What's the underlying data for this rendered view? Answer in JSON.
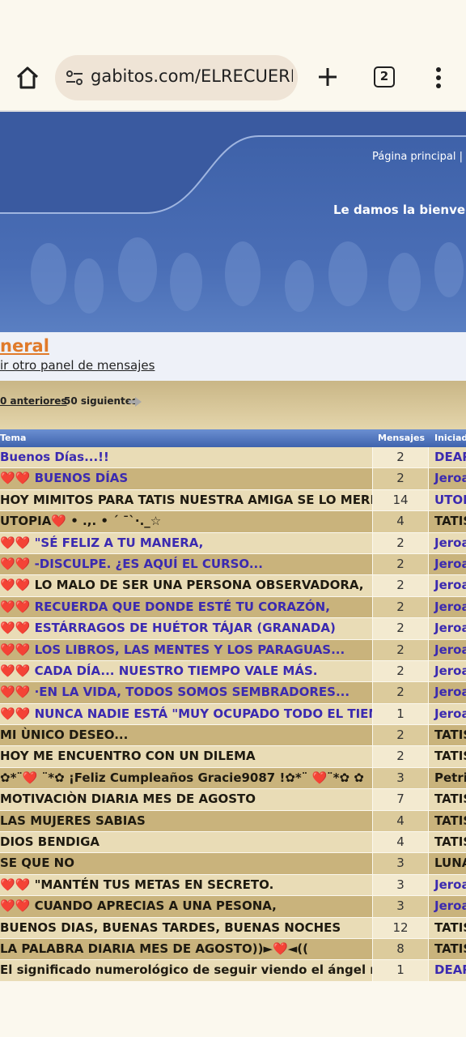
{
  "browser": {
    "url": "gabitos.com/ELRECUERDO",
    "tab_count": "2",
    "icons": [
      "home-icon",
      "site-settings-icon",
      "plus-icon",
      "tabs-icon",
      "more-vert-icon"
    ]
  },
  "header": {
    "nav": "Página principal  |",
    "welcome": "Le damos la bienvenida"
  },
  "forum": {
    "title": "neral",
    "go_link": "ir otro panel de mensajes"
  },
  "pager": {
    "prev": "0 anteriores",
    "next": "50 siguientes"
  },
  "table": {
    "columns": [
      "Tema",
      "Mensajes",
      "Iniciado"
    ],
    "rows": [
      {
        "title": "Buenos Días...!!",
        "count": "2",
        "author": "DEAR",
        "style": "link"
      },
      {
        "title": "❤️❤️ BUENOS DÍAS",
        "count": "2",
        "author": "Jeroa",
        "style": "link"
      },
      {
        "title": "HOY MIMITOS PARA TATIS NUESTRA AMIGA SE LO MERECE",
        "count": "14",
        "author": "UTOP",
        "style": "dark"
      },
      {
        "title": "UTOPIA❤️ • .,. • ´ ¯`·._☆",
        "count": "4",
        "author": "TATIS",
        "style": "dark"
      },
      {
        "title": "❤️❤️ \"SÉ FELIZ A TU MANERA,",
        "count": "2",
        "author": "Jeroa",
        "style": "link"
      },
      {
        "title": "❤️❤️ -DISCULPE. ¿ES AQUÍ EL CURSO...",
        "count": "2",
        "author": "Jeroa",
        "style": "link"
      },
      {
        "title": "❤️❤️ LO MALO DE SER UNA PERSONA OBSERVADORA,",
        "count": "2",
        "author": "Jeroa",
        "style": "dark"
      },
      {
        "title": "❤️❤️ RECUERDA QUE DONDE ESTÉ TU CORAZÓN,",
        "count": "2",
        "author": "Jeroa",
        "style": "link"
      },
      {
        "title": "❤️❤️ ESTÁRRAGOS DE HUÉTOR TÁJAR (GRANADA)",
        "count": "2",
        "author": "Jeroa",
        "style": "link"
      },
      {
        "title": "❤️❤️ LOS LIBROS, LAS MENTES Y LOS PARAGUAS...",
        "count": "2",
        "author": "Jeroa",
        "style": "link"
      },
      {
        "title": "❤️❤️ CADA DÍA... NUESTRO TIEMPO VALE MÁS.",
        "count": "2",
        "author": "Jeroa",
        "style": "link"
      },
      {
        "title": "❤️❤️ ·EN LA VIDA, TODOS SOMOS SEMBRADORES...",
        "count": "2",
        "author": "Jeroa",
        "style": "link"
      },
      {
        "title": "❤️❤️ NUNCA NADIE ESTÁ \"MUY OCUPADO TODO EL TIEMPO",
        "count": "1",
        "author": "Jeroa",
        "style": "link"
      },
      {
        "title": "MI ÙNICO DESEO...",
        "count": "2",
        "author": "TATIS",
        "style": "dark"
      },
      {
        "title": "HOY ME ENCUENTRO CON UN DILEMA",
        "count": "2",
        "author": "TATIS",
        "style": "dark"
      },
      {
        "title": "✿*¨❤️ ¨*✿ ¡Feliz Cumpleaños Gracie9087 !✿*¨ ❤️¨*✿ ✿",
        "count": "3",
        "author": "Petri",
        "style": "dark"
      },
      {
        "title": "MOTIVACIÒN DIARIA MES DE AGOSTO",
        "count": "7",
        "author": "TATIS",
        "style": "dark"
      },
      {
        "title": "LAS MUJERES SABIAS",
        "count": "4",
        "author": "TATIS",
        "style": "dark"
      },
      {
        "title": "DIOS BENDIGA",
        "count": "4",
        "author": "TATIS",
        "style": "dark"
      },
      {
        "title": "SE QUE NO",
        "count": "3",
        "author": "LUNA",
        "style": "dark"
      },
      {
        "title": "❤️❤️ \"MANTÉN TUS METAS EN SECRETO.",
        "count": "3",
        "author": "Jeroa",
        "style": "dark"
      },
      {
        "title": "❤️❤️ CUANDO APRECIAS A UNA PESONA,",
        "count": "3",
        "author": "Jeroa",
        "style": "dark"
      },
      {
        "title": "BUENOS DIAS, BUENAS TARDES, BUENAS NOCHES",
        "count": "12",
        "author": "TATIS",
        "style": "dark"
      },
      {
        "title": "LA PALABRA DIARIA MES DE AGOSTO))►❤️◄((",
        "count": "8",
        "author": "TATIS",
        "style": "dark"
      },
      {
        "title": "El significado numerológico de seguir viendo el ángel número",
        "count": "1",
        "author": "DEAR",
        "style": "dark"
      }
    ]
  }
}
